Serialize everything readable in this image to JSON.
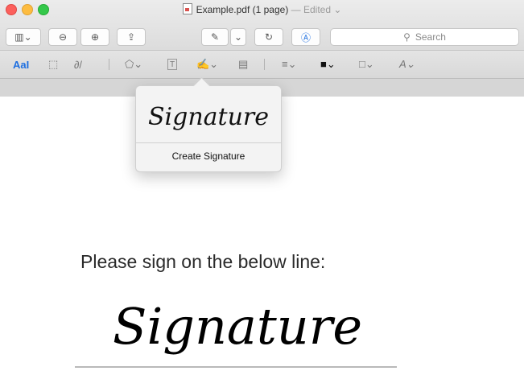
{
  "window": {
    "title": "Example.pdf (1 page)",
    "status": "— Edited ⌄"
  },
  "toolbar": {
    "sidebar_icon": "▥⌄",
    "zoom_out_icon": "⊖",
    "zoom_in_icon": "⊕",
    "share_icon": "⇪",
    "pen_icon": "✎",
    "pen_dropdown": "⌄",
    "rotate_icon": "↻",
    "markup_icon": "Ⓐ",
    "search_placeholder": "Search"
  },
  "markup_toolbar": {
    "text_tool": "AaI",
    "selection_icon": "⬚",
    "sketch_icon": "∂/",
    "shapes_icon": "⬠⌄",
    "textbox_icon": "T",
    "sign_icon": "✍⌄",
    "note_icon": "▤",
    "line_style_icon": "≡⌄",
    "border_color_icon": "■⌄",
    "fill_color_icon": "□⌄",
    "font_icon": "A⌄"
  },
  "popover": {
    "signature_preview": "Signature",
    "create_label": "Create Signature"
  },
  "document": {
    "instruction": "Please sign on the below line:",
    "signature": "Signature"
  }
}
